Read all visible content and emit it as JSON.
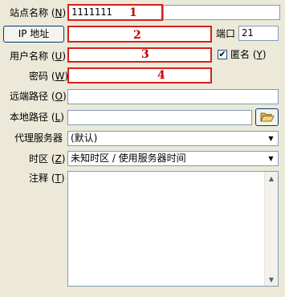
{
  "site_name": {
    "label": "站点名称",
    "key": "N",
    "value": "1111111",
    "marker": "1"
  },
  "ip": {
    "button_label": "IP 地址",
    "value": "",
    "marker": "2"
  },
  "port": {
    "label": "端口",
    "value": "21"
  },
  "username": {
    "label": "用户名称",
    "key": "U",
    "value": "",
    "marker": "3"
  },
  "anonymous": {
    "label": "匿名",
    "key": "Y",
    "checked": true
  },
  "password": {
    "label": "密码",
    "key": "W",
    "value": "",
    "marker": "4"
  },
  "remote_path": {
    "label": "远端路径",
    "key": "O",
    "value": ""
  },
  "local_path": {
    "label": "本地路径",
    "key": "L",
    "value": "",
    "browse_icon": "folder-open-icon"
  },
  "proxy": {
    "label": "代理服务器",
    "selected": "(默认)"
  },
  "timezone": {
    "label": "时区",
    "key": "Z",
    "selected": "未知时区 / 使用服务器时间"
  },
  "notes": {
    "label": "注释",
    "key": "T",
    "value": ""
  },
  "colors": {
    "highlight": "#d32020",
    "marker": "#c00000"
  }
}
